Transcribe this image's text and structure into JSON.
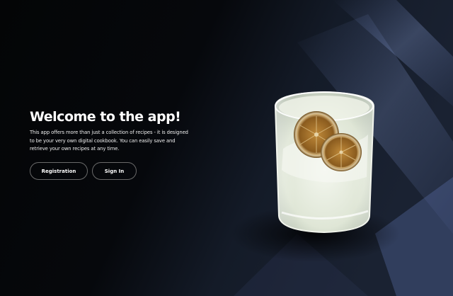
{
  "hero": {
    "title": "Welcome to the app!",
    "description": "This app offers more than just a collection of recipes - it is designed to be your very own digital cookbook. You can easily save and retrieve your own recipes at any time."
  },
  "actions": {
    "registration_label": "Registration",
    "signin_label": "Sign In"
  },
  "colors": {
    "background": "#050608",
    "text": "#ffffff",
    "button_border": "#6a6a6a",
    "drink": "#e6ecdf",
    "lime_slice": "#9a6a22"
  }
}
